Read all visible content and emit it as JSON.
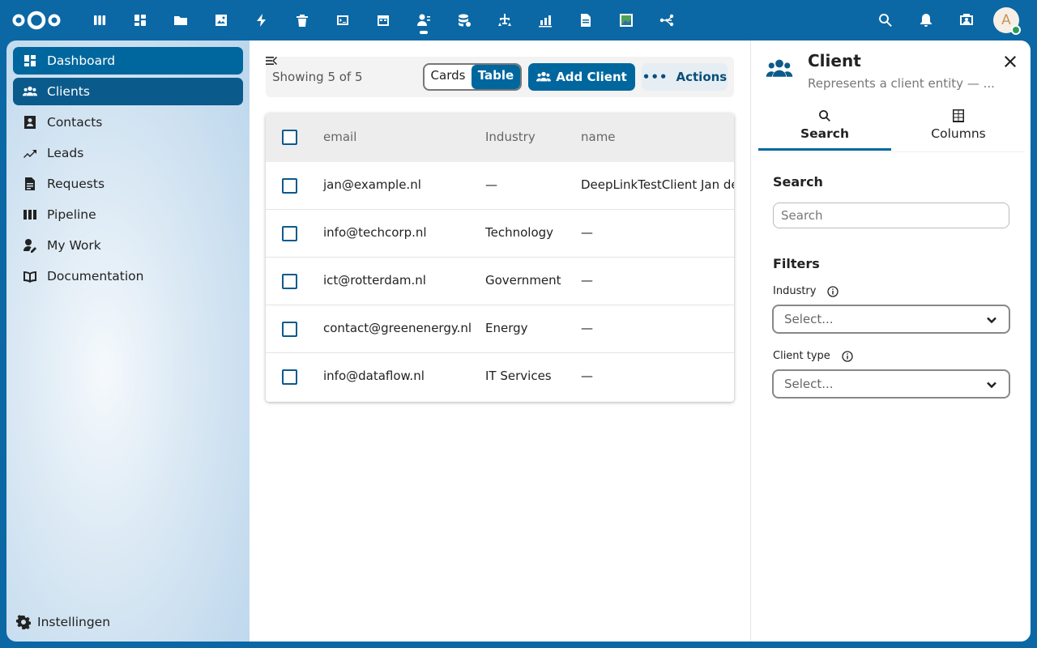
{
  "header": {
    "apps": [
      {
        "icon": "deck-icon"
      },
      {
        "icon": "dashboard-icon"
      },
      {
        "icon": "files-icon"
      },
      {
        "icon": "photos-icon"
      },
      {
        "icon": "activity-icon"
      },
      {
        "icon": "trash-icon"
      },
      {
        "icon": "code-icon"
      },
      {
        "icon": "calendar-icon"
      },
      {
        "icon": "contacts-icon"
      },
      {
        "icon": "database-icon"
      },
      {
        "icon": "hierarchy-icon"
      },
      {
        "icon": "chart-icon"
      },
      {
        "icon": "document-icon"
      },
      {
        "icon": "image-icon"
      },
      {
        "icon": "flow-icon"
      }
    ],
    "right_icons": [
      "search-icon",
      "notifications-icon",
      "contacts-menu-icon"
    ],
    "avatar_initial": "A"
  },
  "sidebar": {
    "items": [
      {
        "label": "Dashboard",
        "icon": "dashboard-icon"
      },
      {
        "label": "Clients",
        "icon": "clients-icon"
      },
      {
        "label": "Contacts",
        "icon": "contact-card-icon"
      },
      {
        "label": "Leads",
        "icon": "trend-icon"
      },
      {
        "label": "Requests",
        "icon": "document-icon"
      },
      {
        "label": "Pipeline",
        "icon": "pipeline-icon"
      },
      {
        "label": "My Work",
        "icon": "user-edit-icon"
      },
      {
        "label": "Documentation",
        "icon": "book-icon"
      }
    ],
    "settings_label": "Instellingen"
  },
  "main": {
    "showing": "Showing 5 of 5",
    "view_cards": "Cards",
    "view_table": "Table",
    "add_label": "Add Client",
    "actions_label": "Actions",
    "columns": [
      "email",
      "Industry",
      "name"
    ],
    "rows": [
      {
        "email": "jan@example.nl",
        "industry": "—",
        "name": "DeepLinkTestClient Jan de"
      },
      {
        "email": "info@techcorp.nl",
        "industry": "Technology",
        "name": "—"
      },
      {
        "email": "ict@rotterdam.nl",
        "industry": "Government",
        "name": "—"
      },
      {
        "email": "contact@greenenergy.nl",
        "industry": "Energy",
        "name": "—"
      },
      {
        "email": "info@dataflow.nl",
        "industry": "IT Services",
        "name": "—"
      }
    ]
  },
  "panel": {
    "title": "Client",
    "subtitle": "Represents a client entity — ...",
    "tabs": [
      "Search",
      "Columns"
    ],
    "search_heading": "Search",
    "search_placeholder": "Search",
    "filters_heading": "Filters",
    "filters": [
      {
        "label": "Industry",
        "placeholder": "Select..."
      },
      {
        "label": "Client type",
        "placeholder": "Select..."
      }
    ]
  },
  "colors": {
    "primary": "#00679e",
    "header": "#0b68a5"
  }
}
